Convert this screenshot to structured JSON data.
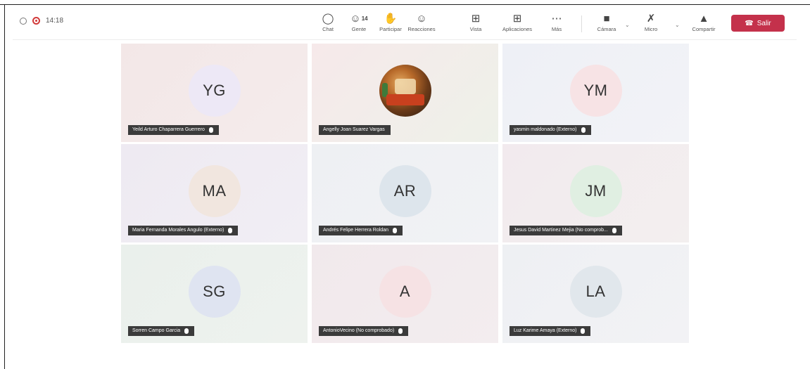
{
  "status": {
    "time": "14:18"
  },
  "toolbar": {
    "chat": "Chat",
    "people": "Gente",
    "people_count": "14",
    "raise": "Participar",
    "react": "Reacciones",
    "view": "Vista",
    "apps": "Aplicaciones",
    "more": "Más",
    "camera": "Cámara",
    "mic": "Micro",
    "share": "Compartir",
    "leave": "Salir"
  },
  "participants": [
    {
      "initials": "YG",
      "name": "Yeild Arturo Chaparrera Guerrero",
      "bg": "#ede8f6",
      "tile_bg": "linear-gradient(135deg,#f3e7e7,#f4ecec)"
    },
    {
      "initials": "",
      "name": "Angelly Joan Suarez Vargas",
      "bg": "",
      "tile_bg": "linear-gradient(135deg,#f6e9ea,#eef1e9)"
    },
    {
      "initials": "YM",
      "name": "yasmin maldonado (Externo)",
      "bg": "#f7e3e5",
      "tile_bg": "linear-gradient(135deg,#eef0f6,#f2f3f7)"
    },
    {
      "initials": "MA",
      "name": "Maria Fernanda Morales Angulo (Externo)",
      "bg": "#f1e6df",
      "tile_bg": "linear-gradient(135deg,#eeeaf2,#f1eef4)"
    },
    {
      "initials": "AR",
      "name": "Andrés Felipe Herrera Roldan",
      "bg": "#dde5ec",
      "tile_bg": "linear-gradient(135deg,#eef0f3,#f1f2f5)"
    },
    {
      "initials": "JM",
      "name": "Jesus David Martinez Mejia (No comprob...",
      "bg": "#e0efe2",
      "tile_bg": "linear-gradient(135deg,#f2eaee,#f3efef)"
    },
    {
      "initials": "SG",
      "name": "Sorren Campo Garcia",
      "bg": "#dfe4f1",
      "tile_bg": "linear-gradient(135deg,#eaf0ec,#eef2ee)"
    },
    {
      "initials": "A",
      "name": "AntonioVecino (No comprobado)",
      "bg": "#f6e2e4",
      "tile_bg": "linear-gradient(135deg,#f1e9ec,#f3edef)"
    },
    {
      "initials": "LA",
      "name": "Luz Karime Amaya (Externo)",
      "bg": "#e1e7ec",
      "tile_bg": "linear-gradient(135deg,#eef0f3,#f2f2f5)"
    }
  ]
}
